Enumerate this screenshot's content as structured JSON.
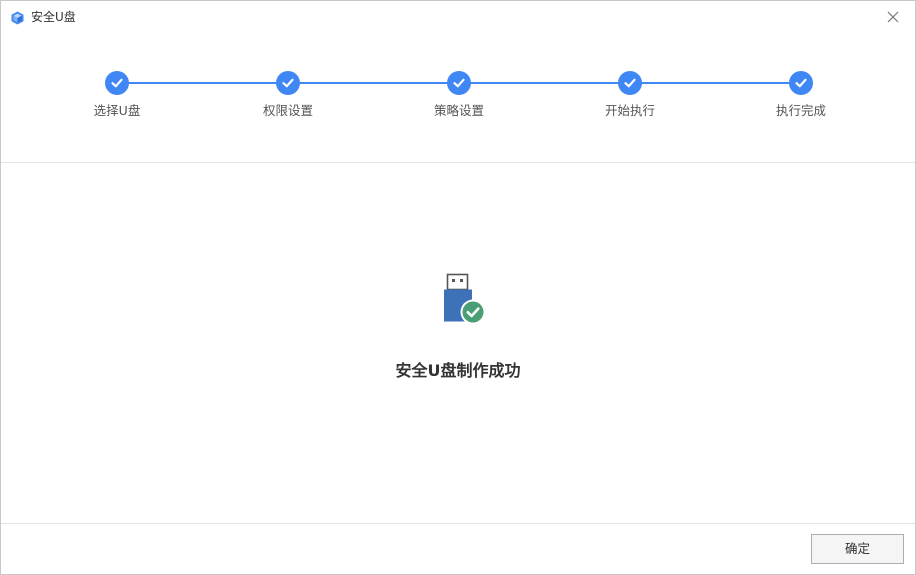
{
  "window": {
    "title": "安全U盘",
    "app_icon": "cube-icon",
    "close_icon": "close-icon"
  },
  "stepper": {
    "accent_color": "#3f87f5",
    "steps": [
      {
        "label": "选择U盘",
        "status": "completed",
        "icon": "check-icon"
      },
      {
        "label": "权限设置",
        "status": "completed",
        "icon": "check-icon"
      },
      {
        "label": "策略设置",
        "status": "completed",
        "icon": "check-icon"
      },
      {
        "label": "开始执行",
        "status": "completed",
        "icon": "check-icon"
      },
      {
        "label": "执行完成",
        "status": "completed",
        "icon": "check-icon"
      }
    ]
  },
  "content": {
    "icon": "usb-success-icon",
    "message": "安全U盘制作成功"
  },
  "footer": {
    "ok_label": "确定"
  },
  "colors": {
    "accent": "#3f87f5",
    "usb_body": "#3d72b8",
    "success_green": "#4a9e73"
  }
}
